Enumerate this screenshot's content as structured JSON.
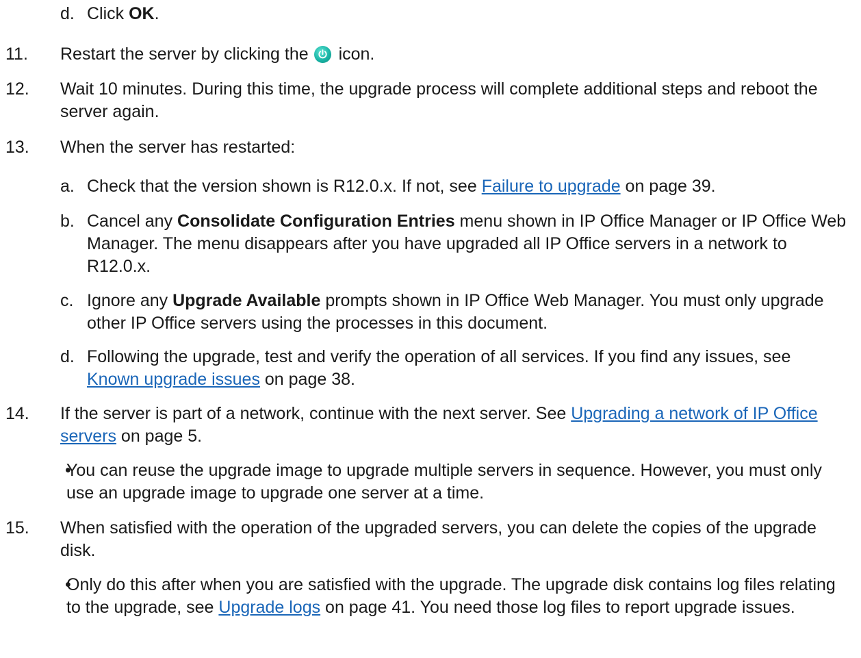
{
  "step_d_first": {
    "label": "d.",
    "text": "Click ",
    "bold": "OK",
    "end": "."
  },
  "step11": {
    "num": "11.",
    "before": "Restart the server by clicking the",
    "after": "icon.",
    "icon": "power-icon"
  },
  "step12": {
    "num": "12.",
    "text": "Wait 10 minutes. During this time, the upgrade process will complete additional steps and reboot the server again."
  },
  "step13": {
    "num": "13.",
    "text": "When the server has restarted:",
    "a": {
      "label": "a.",
      "before": "Check that the version shown is R12.0.x. If not, see ",
      "link": "Failure to upgrade",
      "after": " on page 39."
    },
    "b": {
      "label": "b.",
      "before": "Cancel any ",
      "bold": "Consolidate Configuration Entries",
      "after": " menu shown in IP Office Manager or IP Office Web Manager. The menu disappears after you have upgraded all IP Office servers in a network to R12.0.x."
    },
    "c": {
      "label": "c.",
      "before": "Ignore any ",
      "bold": "Upgrade Available",
      "after": " prompts shown in IP Office Web Manager. You must only upgrade other IP Office servers using the processes in this document."
    },
    "d": {
      "label": "d.",
      "before": "Following the upgrade, test and verify the operation of all services. If you find any issues, see ",
      "link": "Known upgrade issues",
      "after": " on page 38."
    }
  },
  "step14": {
    "num": "14.",
    "before": "If the server is part of a network, continue with the next server. See ",
    "link": "Upgrading a network of IP Office servers",
    "after": " on page 5.",
    "bullet": "You can reuse the upgrade image to upgrade multiple servers in sequence. However, you must only use an upgrade image to upgrade one server at a time."
  },
  "step15": {
    "num": "15.",
    "text": "When satisfied with the operation of the upgraded servers, you can delete the copies of the upgrade disk.",
    "bullet_before": "Only do this after when you are satisfied with the upgrade. The upgrade disk contains log files relating to the upgrade, see ",
    "bullet_link": "Upgrade logs",
    "bullet_after": " on page 41. You need those log files to report upgrade issues."
  },
  "bullet_char": "•"
}
